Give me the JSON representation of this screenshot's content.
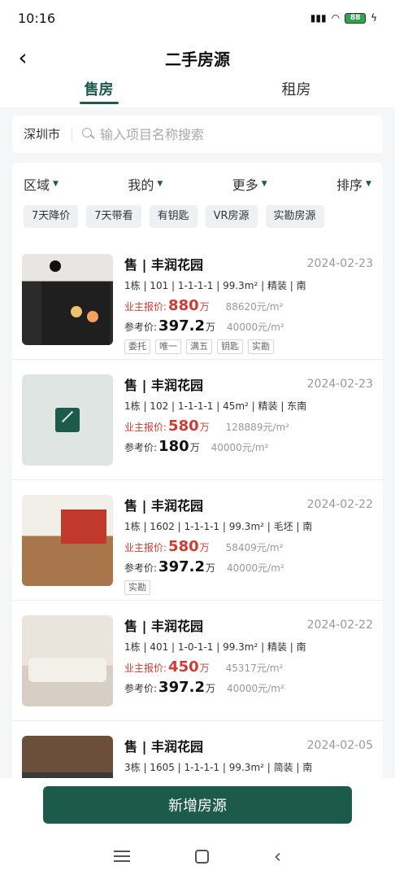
{
  "status": {
    "time": "10:16",
    "battery": "88"
  },
  "header": {
    "title": "二手房源"
  },
  "tabs": [
    {
      "label": "售房"
    },
    {
      "label": "租房"
    }
  ],
  "search": {
    "city": "深圳市",
    "placeholder": "输入项目名称搜索"
  },
  "filters": [
    {
      "label": "区域"
    },
    {
      "label": "我的"
    },
    {
      "label": "更多"
    },
    {
      "label": "排序"
    }
  ],
  "chips": [
    "7天降价",
    "7天带看",
    "有钥匙",
    "VR房源",
    "实勘房源"
  ],
  "listings": [
    {
      "title": "售 | 丰润花园",
      "date": "2024-02-23",
      "spec": "1栋 | 101 | 1-1-1-1 | 99.3m² | 精装 | 南",
      "owner_label": "业主报价:",
      "owner_price": "880",
      "unit": "万",
      "owner_sqm": "88620元/m²",
      "ref_label": "参考价:",
      "ref_price": "397.2",
      "ref_sqm": "40000元/m²",
      "tags": [
        "委托",
        "唯一",
        "满五",
        "钥匙",
        "实勘"
      ]
    },
    {
      "title": "售 | 丰润花园",
      "date": "2024-02-23",
      "spec": "1栋 | 102 | 1-1-1-1 | 45m² | 精装 | 东南",
      "owner_label": "业主报价:",
      "owner_price": "580",
      "unit": "万",
      "owner_sqm": "128889元/m²",
      "ref_label": "参考价:",
      "ref_price": "180",
      "ref_sqm": "40000元/m²",
      "tags": []
    },
    {
      "title": "售 | 丰润花园",
      "date": "2024-02-22",
      "spec": "1栋 | 1602 | 1-1-1-1 | 99.3m² | 毛坯 | 南",
      "owner_label": "业主报价:",
      "owner_price": "580",
      "unit": "万",
      "owner_sqm": "58409元/m²",
      "ref_label": "参考价:",
      "ref_price": "397.2",
      "ref_sqm": "40000元/m²",
      "tags": [
        "实勘"
      ]
    },
    {
      "title": "售 | 丰润花园",
      "date": "2024-02-22",
      "spec": "1栋 | 401 | 1-0-1-1 | 99.3m² | 精装 | 南",
      "owner_label": "业主报价:",
      "owner_price": "450",
      "unit": "万",
      "owner_sqm": "45317元/m²",
      "ref_label": "参考价:",
      "ref_price": "397.2",
      "ref_sqm": "40000元/m²",
      "tags": []
    },
    {
      "title": "售 | 丰润花园",
      "date": "2024-02-05",
      "spec": "3栋 | 1605 | 1-1-1-1 | 99.3m² | 简装 | 南"
    }
  ],
  "add_button": "新增房源"
}
